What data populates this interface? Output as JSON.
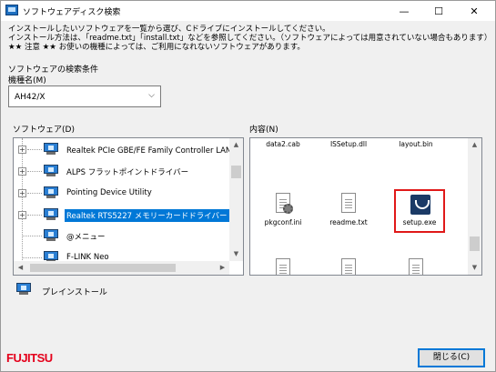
{
  "window": {
    "title": "ソフトウェアディスク検索",
    "minimize": "—",
    "maximize": "☐",
    "close": "✕"
  },
  "instructions": [
    "インストールしたいソフトウェアを一覧から選び、Cドライブにインストールしてください。",
    "インストール方法は、「readme.txt」「install.txt」などを参照してください。（ソフトウェアによっては用意されていない場合もあります）",
    "★★ 注意 ★★ お使いの機種によっては、ご利用になれないソフトウェアがあります。"
  ],
  "search_conditions": {
    "label": "ソフトウェアの検索条件",
    "model_label": "機種名(M)",
    "model_value": "AH42/X"
  },
  "software": {
    "label": "ソフトウェア(D)",
    "items": [
      {
        "label": "Realtek PCIe GBE/FE Family Controller LAN ドラ",
        "expandable": true,
        "selected": false
      },
      {
        "label": "ALPS フラットポイントドライバー",
        "expandable": true,
        "selected": false
      },
      {
        "label": "Pointing Device Utility",
        "expandable": true,
        "selected": false
      },
      {
        "label": "Realtek RTS5227 メモリーカードドライバー",
        "expandable": true,
        "selected": true
      },
      {
        "label": "@メニュー",
        "expandable": false,
        "selected": false
      },
      {
        "label": "F-LINK Neo",
        "expandable": false,
        "selected": false
      }
    ]
  },
  "contents": {
    "label": "内容(N)",
    "files": [
      {
        "name": "data2.cab",
        "icon": "cab-file-icon"
      },
      {
        "name": "ISSetup.dll",
        "icon": "dll-file-icon"
      },
      {
        "name": "layout.bin",
        "icon": "bin-file-icon"
      },
      {
        "name": "pkgconf.ini",
        "icon": "ini-file-icon"
      },
      {
        "name": "readme.txt",
        "icon": "text-file-icon"
      },
      {
        "name": "setup.exe",
        "icon": "setup-exe-icon",
        "highlighted": true
      }
    ]
  },
  "pre_install": {
    "label": "プレインストール"
  },
  "footer": {
    "logo_text": "FUJITSU",
    "close_button": "閉じる(C)"
  },
  "colors": {
    "selection": "#0078d7",
    "highlight_border": "#e01919",
    "brand": "#e4001b"
  }
}
